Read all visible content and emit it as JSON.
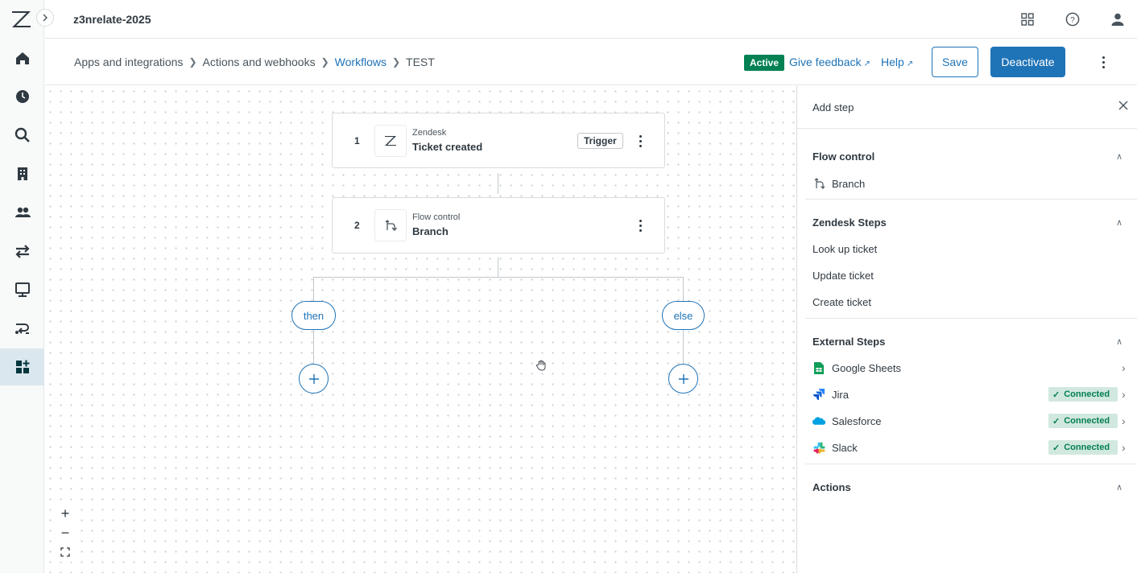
{
  "app": {
    "title": "z3nrelate-2025"
  },
  "breadcrumb": {
    "items": [
      "Apps and integrations",
      "Actions and webhooks",
      "Workflows",
      "TEST"
    ]
  },
  "header": {
    "status_badge": "Active",
    "give_feedback": "Give feedback",
    "help": "Help",
    "save": "Save",
    "deactivate": "Deactivate"
  },
  "workflow": {
    "steps": [
      {
        "number": "1",
        "subtitle": "Zendesk",
        "title": "Ticket created",
        "tag": "Trigger",
        "icon": "zendesk-icon"
      },
      {
        "number": "2",
        "subtitle": "Flow control",
        "title": "Branch",
        "icon": "branch-icon"
      }
    ],
    "branches": {
      "then": "then",
      "else": "else"
    }
  },
  "zoom_controls": {
    "zoom_in": "+",
    "zoom_out": "−"
  },
  "panel": {
    "title": "Add step",
    "sections": [
      {
        "title": "Flow control",
        "items": [
          {
            "label": "Branch",
            "icon": "branch-icon"
          }
        ]
      },
      {
        "title": "Zendesk Steps",
        "items": [
          {
            "label": "Look up ticket"
          },
          {
            "label": "Update ticket"
          },
          {
            "label": "Create ticket"
          }
        ]
      },
      {
        "title": "External Steps",
        "items": [
          {
            "label": "Google Sheets",
            "icon": "google-sheets-icon"
          },
          {
            "label": "Jira",
            "icon": "jira-icon",
            "status": "Connected"
          },
          {
            "label": "Salesforce",
            "icon": "salesforce-icon",
            "status": "Connected"
          },
          {
            "label": "Slack",
            "icon": "slack-icon",
            "status": "Connected"
          }
        ]
      },
      {
        "title": "Actions",
        "items": []
      }
    ]
  },
  "colors": {
    "accent": "#1f73b7",
    "active_green": "#038153",
    "connected_bg": "#d1e8df",
    "nav_active": "#dbe7ee"
  }
}
